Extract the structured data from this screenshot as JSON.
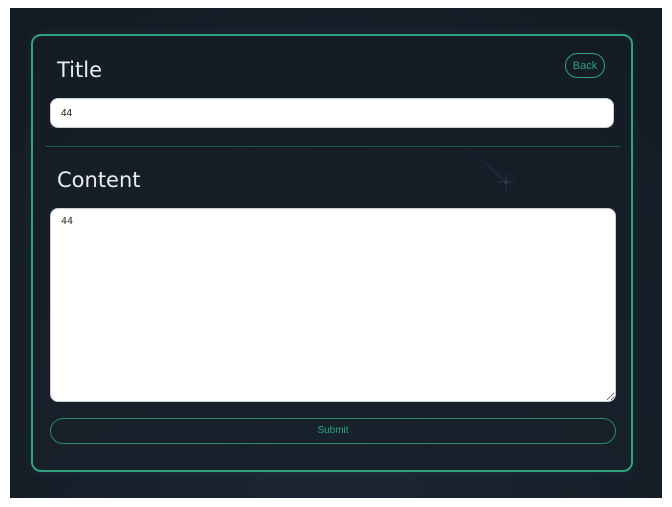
{
  "form": {
    "title_label": "Title",
    "title_value": "44",
    "content_label": "Content",
    "content_value": "44",
    "back_label": "Back",
    "submit_label": "Submit"
  },
  "theme": {
    "accent": "#2ea37d",
    "background": "#18202b",
    "text": "#e8edf2"
  }
}
